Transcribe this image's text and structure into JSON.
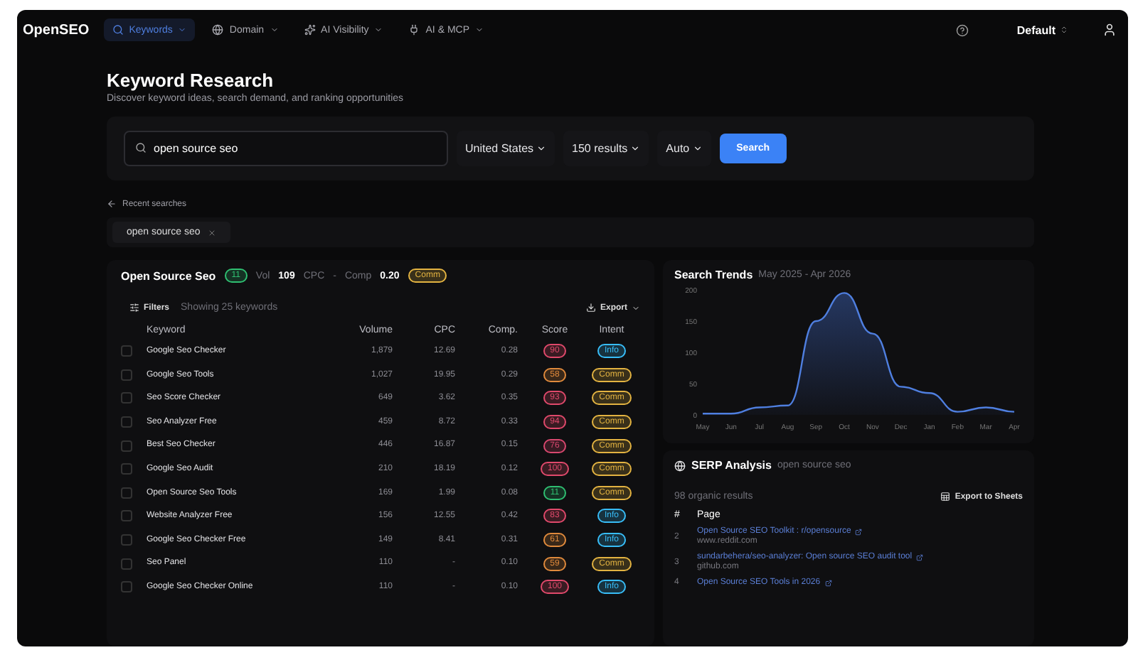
{
  "nav": {
    "logo": "OpenSEO",
    "items": [
      {
        "label": "Keywords",
        "selected": true
      },
      {
        "label": "Domain",
        "selected": false
      },
      {
        "label": "AI Visibility",
        "selected": false
      },
      {
        "label": "AI & MCP",
        "selected": false
      }
    ],
    "profile": "Default"
  },
  "page": {
    "title": "Keyword Research",
    "subtitle": "Discover keyword ideas, search demand, and ranking opportunities"
  },
  "search": {
    "value": "open source seo",
    "country": "United States",
    "results": "150 results",
    "mode": "Auto",
    "button": "Search"
  },
  "recent": {
    "label": "Recent searches",
    "chips": [
      "open source seo"
    ]
  },
  "summary": {
    "keyword": "Open Source Seo",
    "score": "11",
    "vol_label": "Vol",
    "vol": "109",
    "cpc_label": "CPC",
    "cpc": "-",
    "comp_label": "Comp",
    "comp": "0.20",
    "intent": "Comm"
  },
  "table": {
    "filters": "Filters",
    "showing": "Showing 25 keywords",
    "export": "Export",
    "columns": [
      "Keyword",
      "Volume",
      "CPC",
      "Comp.",
      "Score",
      "Intent"
    ],
    "rows": [
      {
        "checked": false,
        "keyword": "Google Seo Checker",
        "volume": "1,879",
        "cpc": "12.69",
        "comp": "0.28",
        "score": "90",
        "color": "#e0496b",
        "intent": "Info",
        "kind": "info"
      },
      {
        "checked": false,
        "keyword": "Google Seo Tools",
        "volume": "1,027",
        "cpc": "19.95",
        "comp": "0.29",
        "score": "58",
        "color": "#e08a3c",
        "intent": "Comm",
        "kind": "comm"
      },
      {
        "checked": false,
        "keyword": "Seo Score Checker",
        "volume": "649",
        "cpc": "3.62",
        "comp": "0.35",
        "score": "93",
        "color": "#e0496b",
        "intent": "Comm",
        "kind": "comm"
      },
      {
        "checked": false,
        "keyword": "Seo Analyzer Free",
        "volume": "459",
        "cpc": "8.72",
        "comp": "0.33",
        "score": "94",
        "color": "#e0496b",
        "intent": "Comm",
        "kind": "comm"
      },
      {
        "checked": false,
        "keyword": "Best Seo Checker",
        "volume": "446",
        "cpc": "16.87",
        "comp": "0.15",
        "score": "76",
        "color": "#d9486f",
        "intent": "Comm",
        "kind": "comm"
      },
      {
        "checked": false,
        "keyword": "Google Seo Audit",
        "volume": "210",
        "cpc": "18.19",
        "comp": "0.12",
        "score": "100",
        "color": "#e0496b",
        "intent": "Comm",
        "kind": "comm"
      },
      {
        "checked": false,
        "keyword": "Open Source Seo Tools",
        "volume": "169",
        "cpc": "1.99",
        "comp": "0.08",
        "score": "11",
        "color": "#2fbf71",
        "intent": "Comm",
        "kind": "comm"
      },
      {
        "checked": false,
        "keyword": "Website Analyzer Free",
        "volume": "156",
        "cpc": "12.55",
        "comp": "0.42",
        "score": "83",
        "color": "#e0496b",
        "intent": "Info",
        "kind": "info"
      },
      {
        "checked": false,
        "keyword": "Google Seo Checker Free",
        "volume": "149",
        "cpc": "8.41",
        "comp": "0.31",
        "score": "61",
        "color": "#e08a3c",
        "intent": "Info",
        "kind": "info"
      },
      {
        "checked": false,
        "keyword": "Seo Panel",
        "volume": "110",
        "cpc": "-",
        "comp": "0.10",
        "score": "59",
        "color": "#e08a3c",
        "intent": "Comm",
        "kind": "comm"
      },
      {
        "checked": false,
        "keyword": "Google Seo Checker Online",
        "volume": "110",
        "cpc": "-",
        "comp": "0.10",
        "score": "100",
        "color": "#e0496b",
        "intent": "Info",
        "kind": "info"
      }
    ]
  },
  "trends": {
    "title": "Search Trends",
    "range": "May 2025 - Apr 2026",
    "chart_data": {
      "type": "area",
      "categories": [
        "May",
        "Jun",
        "Jul",
        "Aug",
        "Sep",
        "Oct",
        "Nov",
        "Dec",
        "Jan",
        "Feb",
        "Mar",
        "Apr"
      ],
      "series": [
        {
          "color": "#4f7fe0",
          "values": [
            2,
            2,
            12,
            15,
            150,
            195,
            130,
            45,
            35,
            5,
            12,
            5
          ]
        }
      ],
      "ylim": [
        0,
        200
      ],
      "yticks": [
        0,
        50,
        100,
        150,
        200
      ]
    }
  },
  "serp": {
    "title": "SERP Analysis",
    "query": "open source seo",
    "count": "98 organic results",
    "export": "Export to Sheets",
    "columns": [
      "#",
      "Page"
    ],
    "rows": [
      {
        "rank": "2",
        "title": "Open Source SEO Toolkit : r/opensource",
        "url": "www.reddit.com"
      },
      {
        "rank": "3",
        "title": "sundarbehera/seo-analyzer: Open source SEO audit tool",
        "url": "github.com"
      },
      {
        "rank": "4",
        "title": "Open Source SEO Tools in 2026"
      }
    ]
  }
}
